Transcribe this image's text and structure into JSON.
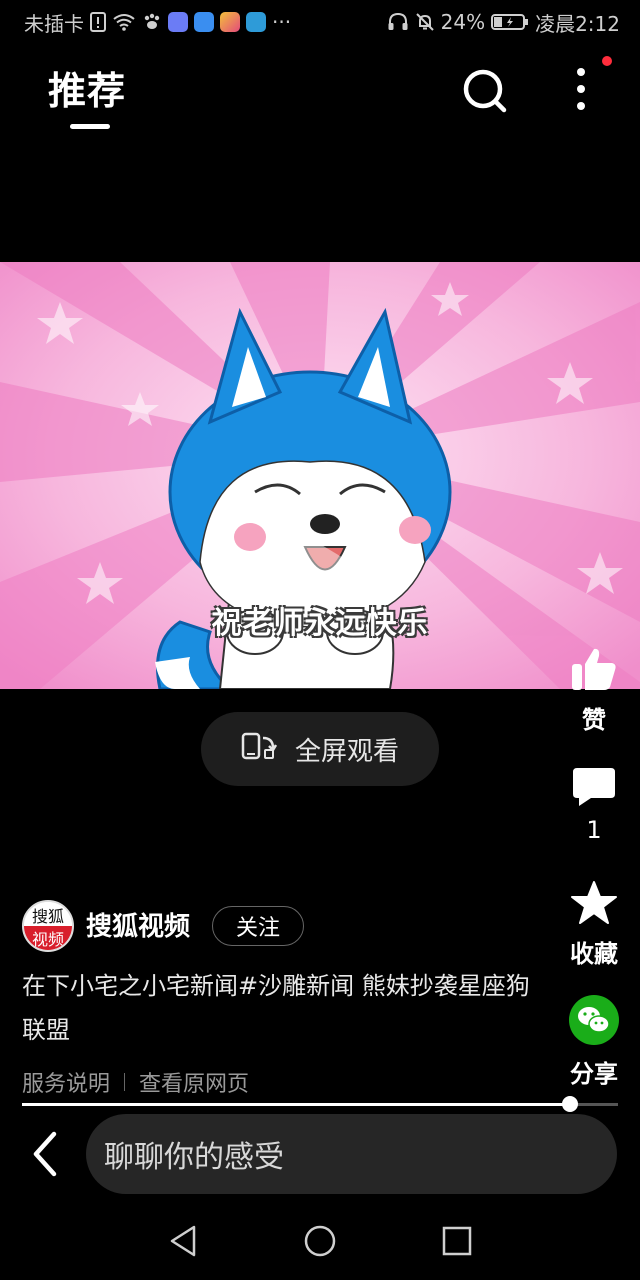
{
  "status_bar": {
    "carrier": "未插卡",
    "more": "···",
    "battery": "24%",
    "time": "凌晨2:12"
  },
  "header": {
    "tab_title": "推荐",
    "icons": {
      "search": "search-icon",
      "more": "more-vertical-icon"
    }
  },
  "video": {
    "subtitle": "祝老师永远快乐",
    "fullscreen_label": "全屏观看",
    "progress": 0.92
  },
  "actions": {
    "like_label": "赞",
    "comment_count": "1",
    "favorite_label": "收藏",
    "share_label": "分享"
  },
  "author": {
    "avatar_text": [
      "搜狐",
      "视频"
    ],
    "name": "搜狐视频",
    "follow_label": "关注"
  },
  "caption": "在下小宅之小宅新闻#沙雕新闻 熊妹抄袭星座狗联盟",
  "links": {
    "service": "服务说明",
    "source": "查看原网页"
  },
  "comment_bar": {
    "placeholder": "聊聊你的感受"
  },
  "colors": {
    "background": "#000000",
    "share_green": "#1aad19",
    "badge_red": "#ff2d3c",
    "avatar_red": "#d81e2b"
  }
}
